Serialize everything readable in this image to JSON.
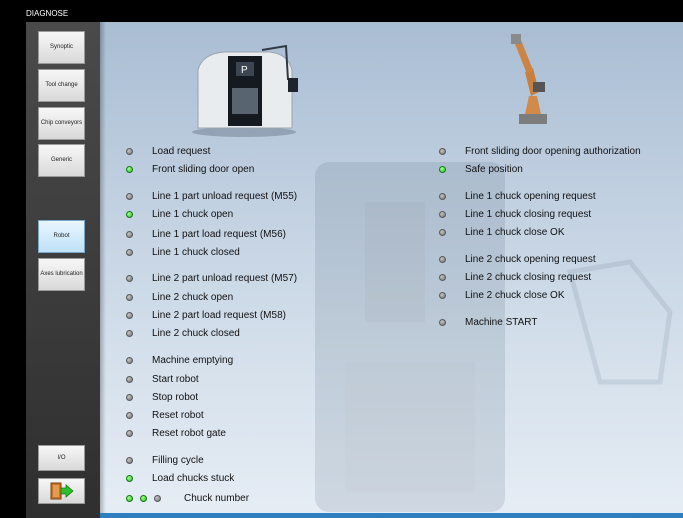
{
  "window": {
    "title": "DIAGNOSE"
  },
  "sidebar": {
    "items": [
      {
        "label": "Synoptic",
        "active": false
      },
      {
        "label": "Tool change",
        "active": false
      },
      {
        "label": "Chip conveyors",
        "active": false
      },
      {
        "label": "Generic",
        "active": false
      },
      {
        "label": "Robot",
        "active": true
      },
      {
        "label": "Axes lubrication",
        "active": false
      }
    ],
    "io_label": "I/O",
    "exit_icon": "exit-door-icon"
  },
  "colors": {
    "led_on": "#21c021",
    "led_off": "#7a7a7a",
    "accent": "#2e7fc0"
  },
  "left_signals": [
    {
      "label": "Load request",
      "state": "off"
    },
    {
      "label": "Front sliding door open",
      "state": "on"
    },
    {
      "label": "Line 1 part unload request (M55)",
      "state": "off"
    },
    {
      "label": "Line 1 chuck open",
      "state": "on"
    },
    {
      "label": "Line 1 part load request (M56)",
      "state": "off"
    },
    {
      "label": "Line 1 chuck closed",
      "state": "off"
    },
    {
      "label": "Line 2 part unload request (M57)",
      "state": "off"
    },
    {
      "label": "Line 2 chuck open",
      "state": "off"
    },
    {
      "label": "Line 2 part load request (M58)",
      "state": "off"
    },
    {
      "label": "Line 2 chuck closed",
      "state": "off"
    },
    {
      "label": "Machine emptying",
      "state": "off"
    },
    {
      "label": "Start robot",
      "state": "off"
    },
    {
      "label": "Stop robot",
      "state": "off"
    },
    {
      "label": "Reset robot",
      "state": "off"
    },
    {
      "label": "Reset robot gate",
      "state": "off"
    },
    {
      "label": "Filling cycle",
      "state": "off"
    },
    {
      "label": "Load chucks stuck",
      "state": "on"
    }
  ],
  "chuck_number": {
    "label": "Chuck number",
    "leds": [
      "on",
      "on",
      "off"
    ]
  },
  "right_signals": [
    {
      "label": "Front sliding door opening authorization",
      "state": "off"
    },
    {
      "label": "Safe position",
      "state": "on"
    },
    {
      "label": "Line 1 chuck opening request",
      "state": "off"
    },
    {
      "label": "Line 1 chuck closing request",
      "state": "off"
    },
    {
      "label": "Line 1 chuck close OK",
      "state": "off"
    },
    {
      "label": "Line 2 chuck opening request",
      "state": "off"
    },
    {
      "label": "Line 2 chuck closing request",
      "state": "off"
    },
    {
      "label": "Line 2 chuck close OK",
      "state": "off"
    },
    {
      "label": "Machine START",
      "state": "off"
    }
  ]
}
